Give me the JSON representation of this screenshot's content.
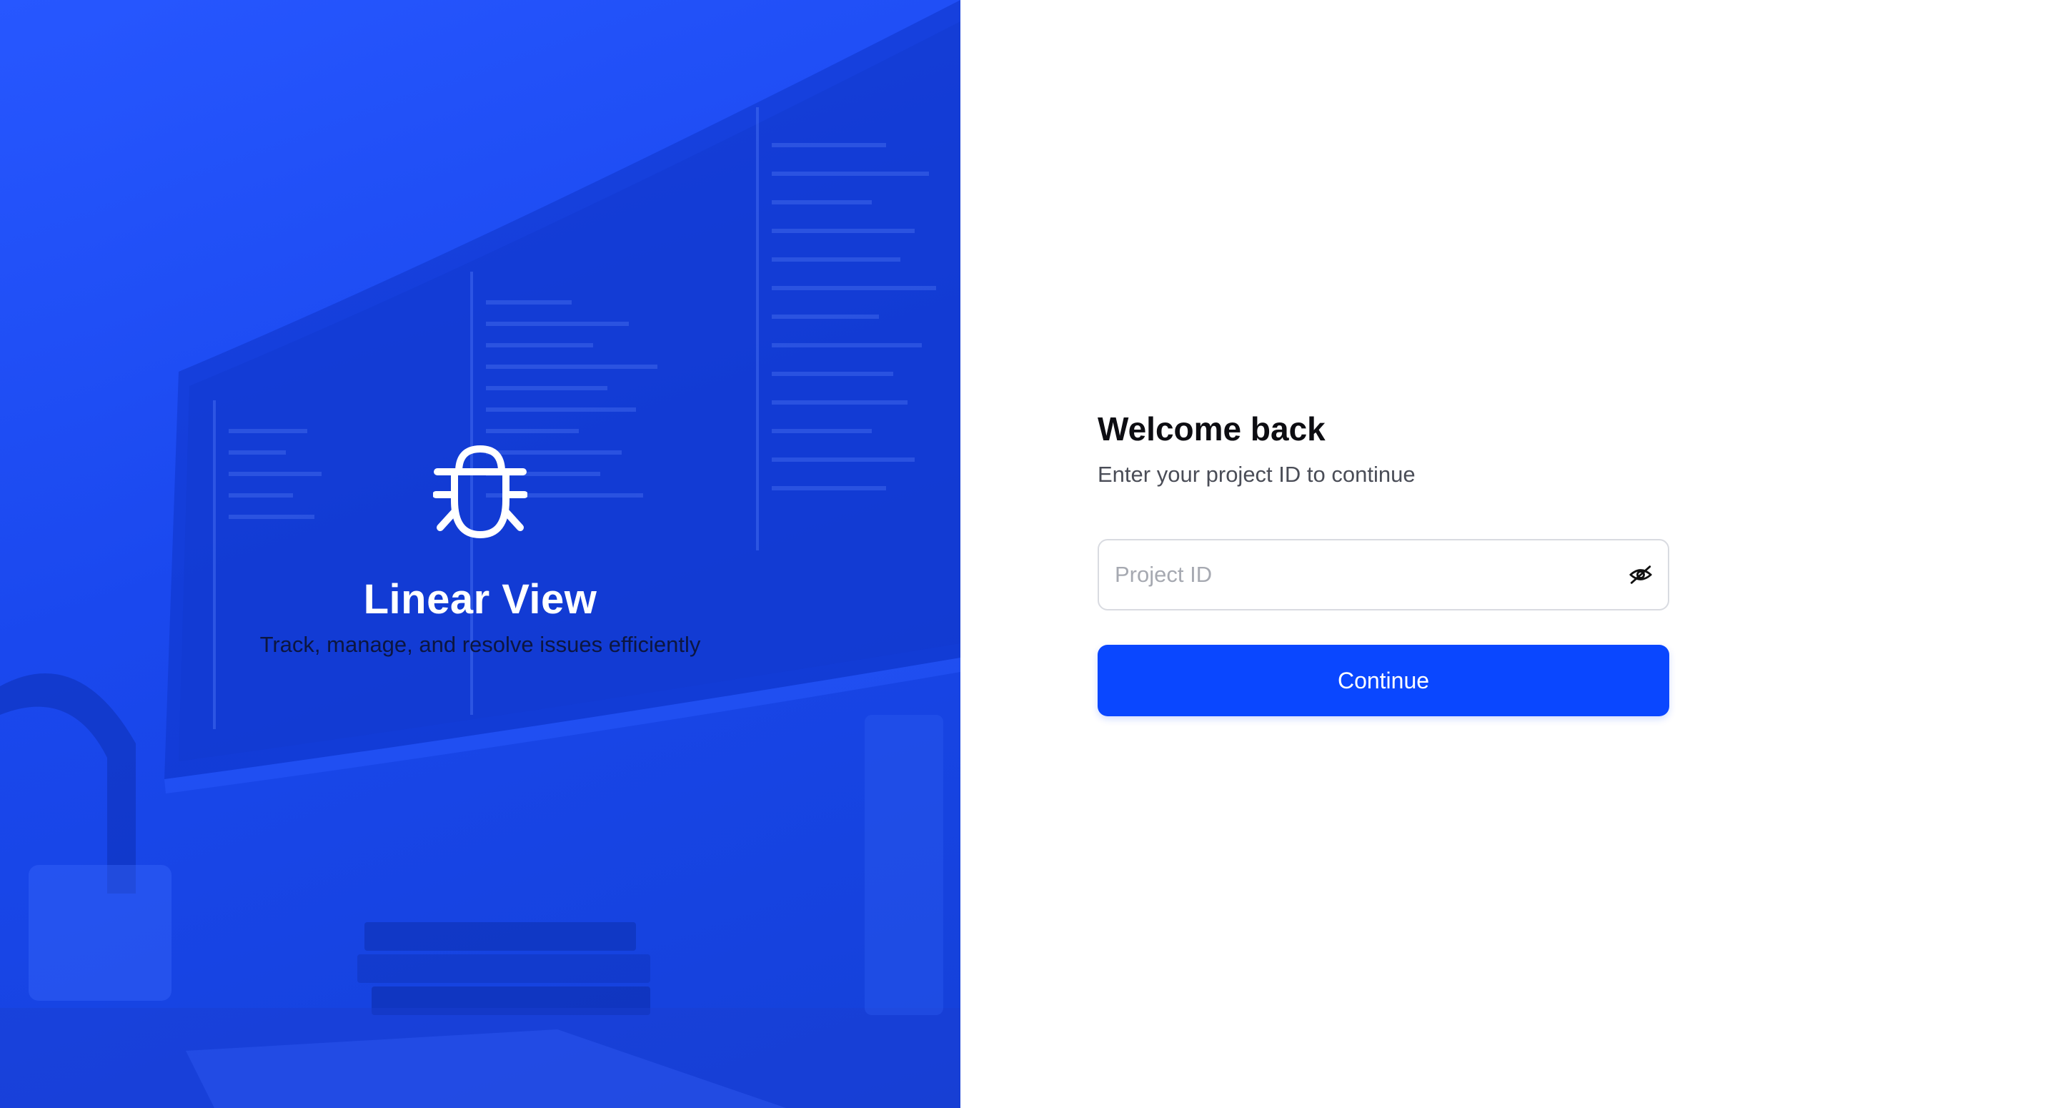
{
  "brand": {
    "icon": "bug-icon",
    "title": "Linear View",
    "tagline": "Track, manage, and resolve issues efficiently"
  },
  "login": {
    "title": "Welcome back",
    "subtitle": "Enter your project ID to continue",
    "project_id": {
      "value": "",
      "placeholder": "Project ID",
      "visibility_toggle_icon": "eye-off-icon"
    },
    "continue_label": "Continue"
  },
  "colors": {
    "accent": "#0a47ff",
    "hero_blue": "#1a48ee",
    "title_text": "#0d0d12",
    "subtitle_text": "#4a4d57",
    "placeholder_text": "#a6a9b1",
    "input_border": "#d9dbe1"
  }
}
